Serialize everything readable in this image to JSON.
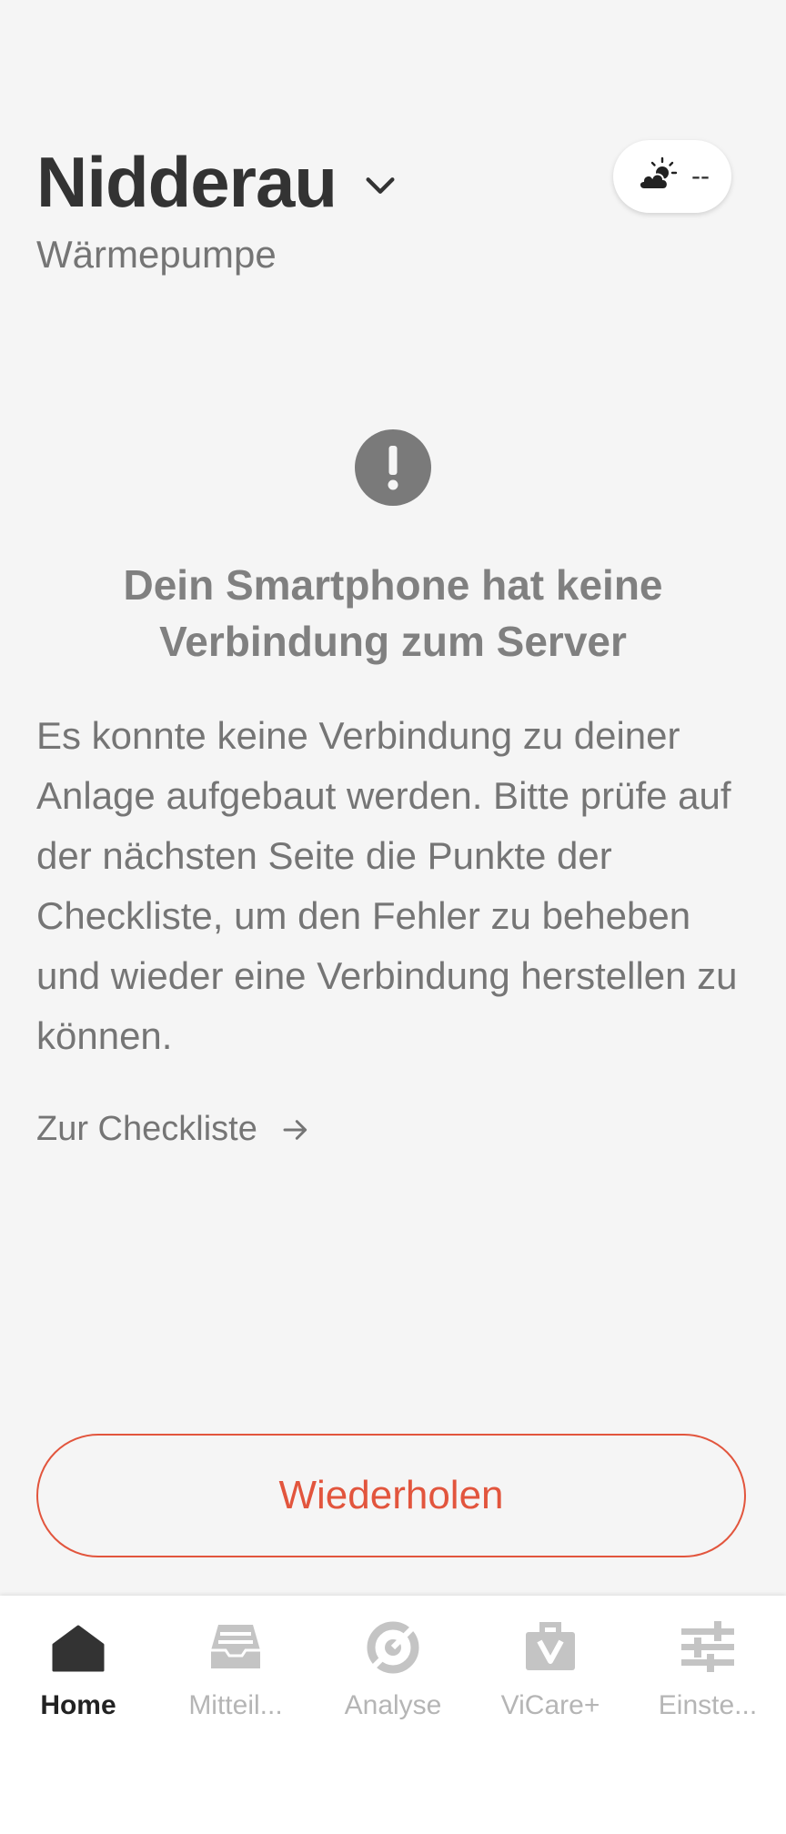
{
  "header": {
    "location": "Nidderau",
    "device_type": "Wärmepumpe"
  },
  "weather": {
    "icon": "cloud-sun-icon",
    "value": "--"
  },
  "error": {
    "icon": "exclamation-icon",
    "title": "Dein Smartphone hat keine Verbindung zum Server",
    "body": "Es konnte keine Verbindung zu deiner Anlage aufgebaut werden. Bitte prüfe auf der nächsten Seite die Punkte der Checkliste, um den Fehler zu beheben und wieder eine Verbindung herstellen zu können.",
    "link_label": "Zur Checkliste"
  },
  "retry_button": {
    "label": "Wiederholen"
  },
  "bottom_nav": {
    "items": [
      {
        "label": "Home",
        "icon": "home-icon",
        "active": true
      },
      {
        "label": "Mitteil...",
        "icon": "inbox-icon",
        "active": false
      },
      {
        "label": "Analyse",
        "icon": "analysis-icon",
        "active": false
      },
      {
        "label": "ViCare+",
        "icon": "vicare-bag-icon",
        "active": false
      },
      {
        "label": "Einste...",
        "icon": "sliders-icon",
        "active": false
      }
    ]
  },
  "colors": {
    "accent": "#e2553d",
    "background": "#f5f5f5",
    "text_dark": "#333333",
    "text_muted": "#757575",
    "nav_inactive": "#b5b5b5"
  }
}
